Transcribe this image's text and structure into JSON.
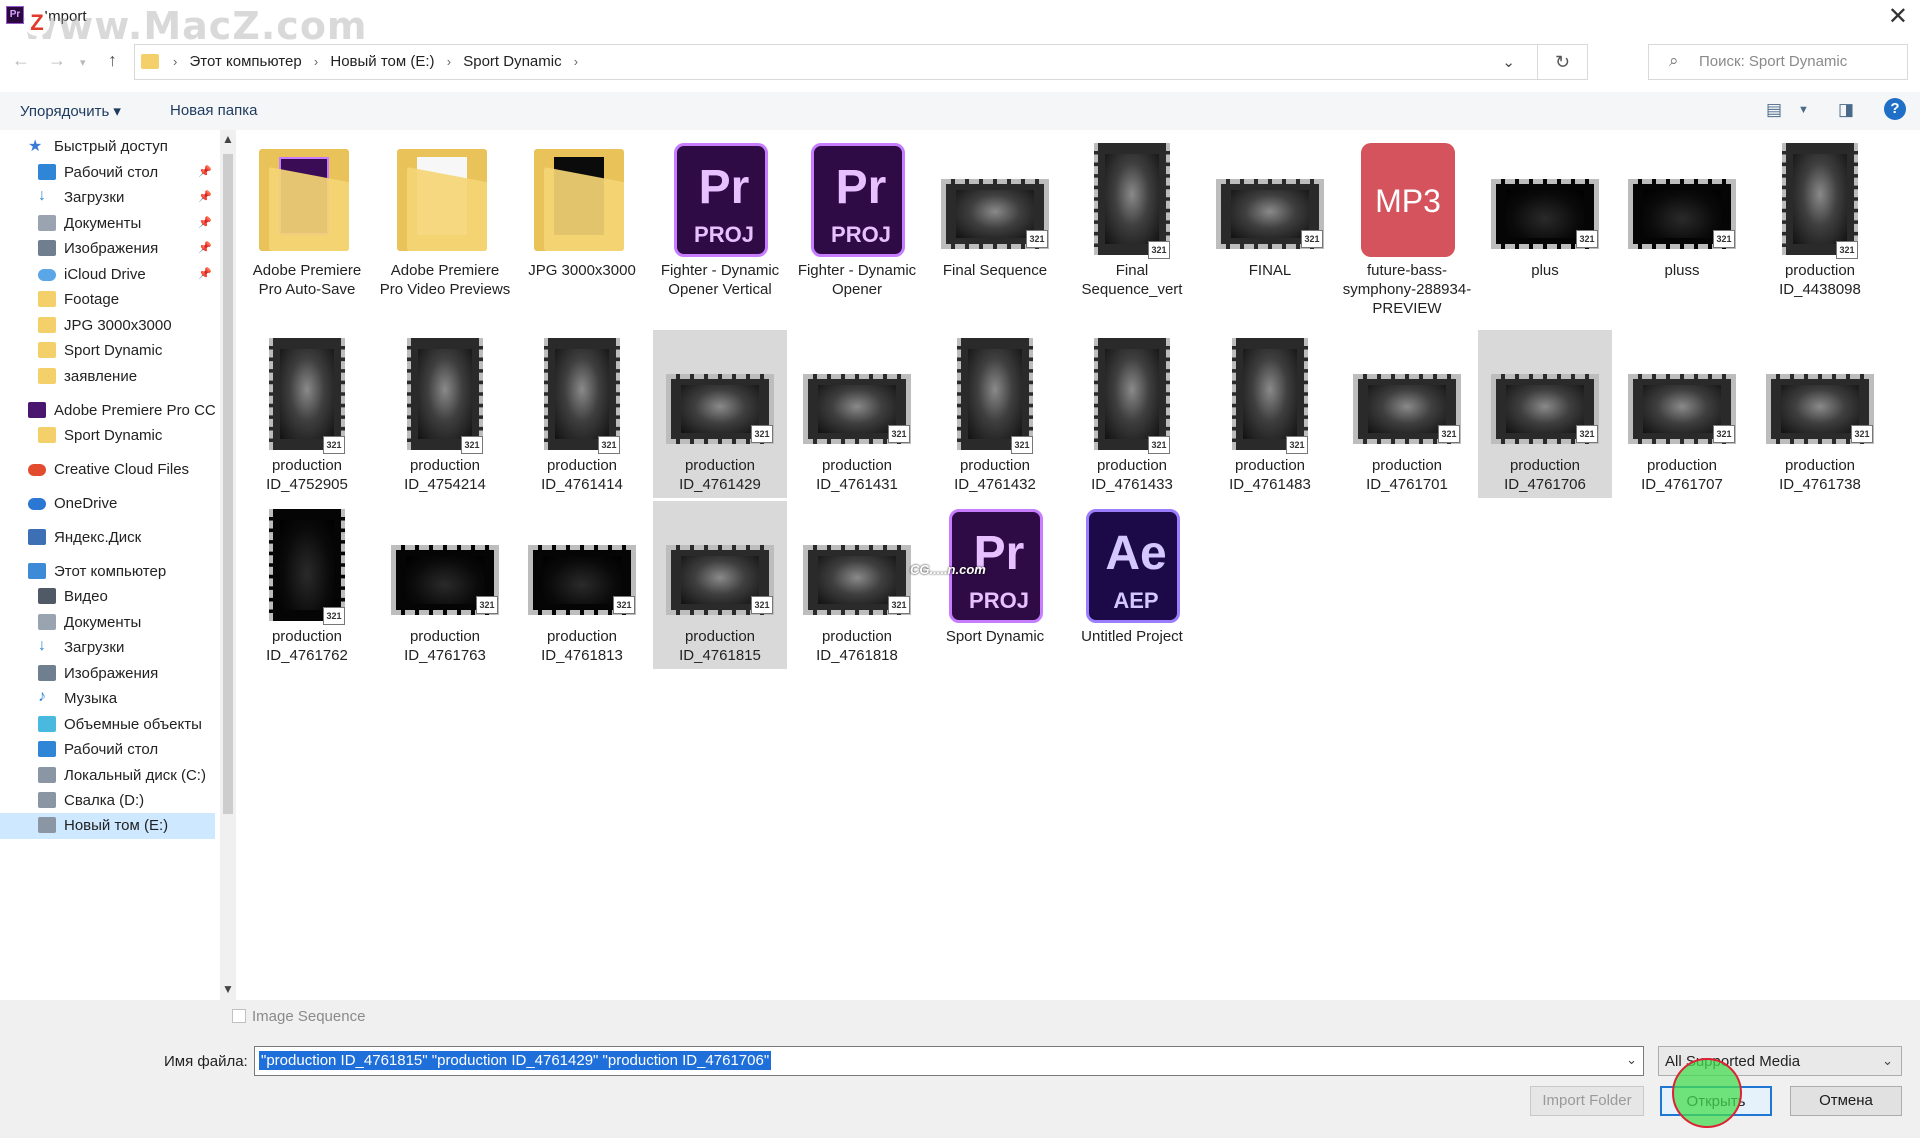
{
  "window": {
    "title": "Import",
    "app_icon": "Pr",
    "watermark": "www.MacZ.com",
    "watermark_logo": "Z"
  },
  "address_bar": {
    "crumbs": [
      "Этот компьютер",
      "Новый том (E:)",
      "Sport Dynamic"
    ],
    "search_placeholder": "Поиск: Sport Dynamic"
  },
  "toolbar": {
    "organize_label": "Упорядочить ▾",
    "new_folder_label": "Новая папка",
    "help_label": "?"
  },
  "sidebar": {
    "items": [
      {
        "label": "Быстрый доступ",
        "icon": "star-icon",
        "color": "#3a7bd5",
        "pinned": false,
        "indent": 0
      },
      {
        "label": "Рабочий стол",
        "icon": "desktop-icon",
        "color": "#2f86d6",
        "pinned": true,
        "indent": 1
      },
      {
        "label": "Загрузки",
        "icon": "download-arrow-icon",
        "color": "#2f86d6",
        "pinned": true,
        "indent": 1
      },
      {
        "label": "Документы",
        "icon": "document-icon",
        "color": "#9aa4b0",
        "pinned": true,
        "indent": 1
      },
      {
        "label": "Изображения",
        "icon": "pictures-icon",
        "color": "#6f7f8f",
        "pinned": true,
        "indent": 1
      },
      {
        "label": "iCloud Drive",
        "icon": "icloud-icon",
        "color": "#5aa6e6",
        "pinned": true,
        "indent": 1
      },
      {
        "label": "Footage",
        "icon": "folder-icon",
        "color": "#f4d06a",
        "pinned": false,
        "indent": 1
      },
      {
        "label": "JPG 3000x3000",
        "icon": "folder-icon",
        "color": "#f4d06a",
        "pinned": false,
        "indent": 1
      },
      {
        "label": "Sport Dynamic",
        "icon": "folder-icon",
        "color": "#f4d06a",
        "pinned": false,
        "indent": 1
      },
      {
        "label": "заявление",
        "icon": "folder-icon",
        "color": "#f4d06a",
        "pinned": false,
        "indent": 1
      },
      {
        "label": "Adobe Premiere Pro CC",
        "icon": "premiere-icon",
        "color": "#4b1670",
        "pinned": false,
        "indent": 0
      },
      {
        "label": "Sport Dynamic",
        "icon": "folder-icon",
        "color": "#f4d06a",
        "pinned": false,
        "indent": 1
      },
      {
        "label": "Creative Cloud Files",
        "icon": "creative-cloud-icon",
        "color": "#e34b2e",
        "pinned": false,
        "indent": 0
      },
      {
        "label": "OneDrive",
        "icon": "onedrive-icon",
        "color": "#2a77d4",
        "pinned": false,
        "indent": 0
      },
      {
        "label": "Яндекс.Диск",
        "icon": "yandex-disk-icon",
        "color": "#3d6fb4",
        "pinned": false,
        "indent": 0
      },
      {
        "label": "Этот компьютер",
        "icon": "computer-icon",
        "color": "#3d8ad6",
        "pinned": false,
        "indent": 0
      },
      {
        "label": "Видео",
        "icon": "video-icon",
        "color": "#505a66",
        "pinned": false,
        "indent": 1
      },
      {
        "label": "Документы",
        "icon": "document-icon",
        "color": "#9aa4b0",
        "pinned": false,
        "indent": 1
      },
      {
        "label": "Загрузки",
        "icon": "download-arrow-icon",
        "color": "#2f86d6",
        "pinned": false,
        "indent": 1
      },
      {
        "label": "Изображения",
        "icon": "pictures-icon",
        "color": "#6f7f8f",
        "pinned": false,
        "indent": 1
      },
      {
        "label": "Музыка",
        "icon": "music-icon",
        "color": "#2f86d6",
        "pinned": false,
        "indent": 1
      },
      {
        "label": "Объемные объекты",
        "icon": "3d-objects-icon",
        "color": "#49b9e0",
        "pinned": false,
        "indent": 1
      },
      {
        "label": "Рабочий стол",
        "icon": "desktop-icon",
        "color": "#2f86d6",
        "pinned": false,
        "indent": 1
      },
      {
        "label": "Локальный диск (C:)",
        "icon": "windows-drive-icon",
        "color": "#8a96a3",
        "pinned": false,
        "indent": 1
      },
      {
        "label": "Свалка (D:)",
        "icon": "drive-icon",
        "color": "#8a96a3",
        "pinned": false,
        "indent": 1
      },
      {
        "label": "Новый том (E:)",
        "icon": "drive-icon",
        "color": "#8a96a3",
        "pinned": false,
        "indent": 1,
        "selected": true
      }
    ]
  },
  "files": [
    {
      "name": "Adobe Premiere Pro Auto-Save",
      "kind": "folder-premiere",
      "selected": false
    },
    {
      "name": "Adobe Premiere Pro Video Previews",
      "kind": "folder-docs",
      "selected": false
    },
    {
      "name": "JPG 3000x3000",
      "kind": "folder-black",
      "selected": false
    },
    {
      "name": "Fighter - Dynamic Opener Vertical",
      "kind": "prproj",
      "selected": false
    },
    {
      "name": "Fighter - Dynamic Opener",
      "kind": "prproj",
      "selected": false
    },
    {
      "name": "Final Sequence",
      "kind": "video-h",
      "selected": false
    },
    {
      "name": "Final Sequence_vert",
      "kind": "video-v",
      "selected": false
    },
    {
      "name": "FINAL",
      "kind": "video-h",
      "selected": false
    },
    {
      "name": "future-bass-symphony-288934-PREVIEW",
      "kind": "mp3",
      "selected": false
    },
    {
      "name": "plus",
      "kind": "video-h-dark",
      "selected": false
    },
    {
      "name": "pluss",
      "kind": "video-h-dark",
      "selected": false
    },
    {
      "name": "production ID_4438098",
      "kind": "video-v",
      "selected": false
    },
    {
      "name": "production ID_4752905",
      "kind": "video-v",
      "selected": false
    },
    {
      "name": "production ID_4754214",
      "kind": "video-v",
      "selected": false
    },
    {
      "name": "production ID_4761414",
      "kind": "video-v",
      "selected": false
    },
    {
      "name": "production ID_4761429",
      "kind": "video-h",
      "selected": true
    },
    {
      "name": "production ID_4761431",
      "kind": "video-h",
      "selected": false
    },
    {
      "name": "production ID_4761432",
      "kind": "video-v",
      "selected": false
    },
    {
      "name": "production ID_4761433",
      "kind": "video-v",
      "selected": false
    },
    {
      "name": "production ID_4761483",
      "kind": "video-v",
      "selected": false
    },
    {
      "name": "production ID_4761701",
      "kind": "video-h",
      "selected": false
    },
    {
      "name": "production ID_4761706",
      "kind": "video-h",
      "selected": true
    },
    {
      "name": "production ID_4761707",
      "kind": "video-h",
      "selected": false
    },
    {
      "name": "production ID_4761738",
      "kind": "video-h",
      "selected": false
    },
    {
      "name": "production ID_4761762",
      "kind": "video-v-dark",
      "selected": false
    },
    {
      "name": "production ID_4761763",
      "kind": "video-h-dark",
      "selected": false
    },
    {
      "name": "production ID_4761813",
      "kind": "video-h-dark",
      "selected": false
    },
    {
      "name": "production ID_4761815",
      "kind": "video-h",
      "selected": true
    },
    {
      "name": "production ID_4761818",
      "kind": "video-h",
      "selected": false
    },
    {
      "name": "Sport Dynamic",
      "kind": "prproj",
      "selected": false
    },
    {
      "name": "Untitled Project",
      "kind": "aep",
      "selected": false
    }
  ],
  "icon_labels": {
    "pr_big": "Pr",
    "pr_small": "PROJ",
    "ae_big": "Ae",
    "ae_small": "AEP",
    "mp3": "MP3",
    "film_badge": "321"
  },
  "content_watermark": "CG.....n.com",
  "bottom": {
    "image_sequence_label": "Image Sequence",
    "file_name_label": "Имя файла:",
    "file_name_value": "\"production ID_4761815\" \"production ID_4761429\" \"production ID_4761706\"",
    "file_type_value": "All Supported Media",
    "import_folder_label": "Import Folder",
    "open_label": "Открыть",
    "cancel_label": "Отмена"
  }
}
